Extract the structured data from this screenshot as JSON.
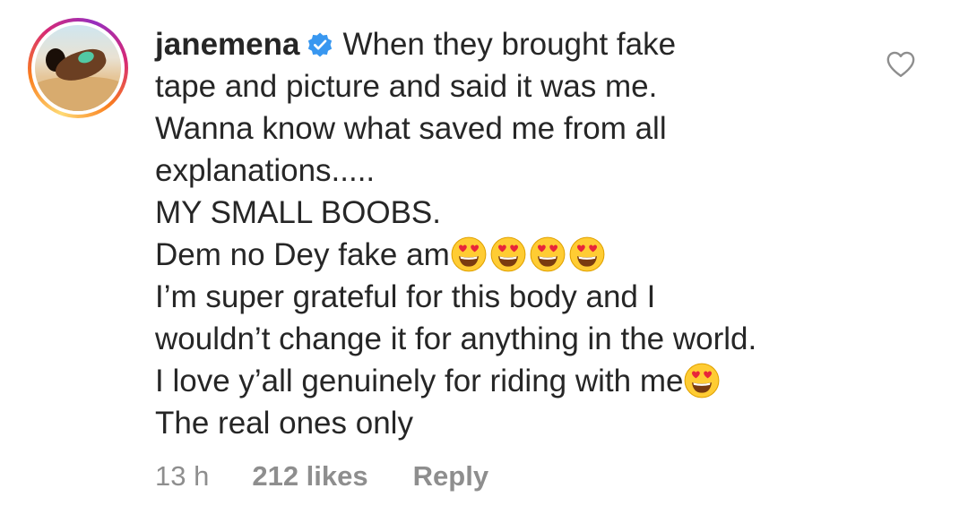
{
  "comment": {
    "username": "janemena",
    "verified_icon": "verified-badge-icon",
    "first_line_text": "When they brought fake",
    "lines": [
      "tape and picture and said it was me.",
      "Wanna know what saved me from all",
      "explanations.....",
      "MY SMALL BOOBS."
    ],
    "emoji_line_1": {
      "text": "Dem no Dey fake am",
      "emoji_icon": "heart-eyes-emoji",
      "emoji_count": 4
    },
    "lines_after": [
      "I’m super grateful for this body and I",
      "wouldn’t change it for anything in the world."
    ],
    "emoji_line_2": {
      "text": "I love y’all genuinely for riding with me",
      "emoji_icon": "heart-eyes-emoji",
      "emoji_count": 1
    },
    "last_line": "The real ones only"
  },
  "meta": {
    "time": "13 h",
    "likes": "212 likes",
    "reply_label": "Reply"
  },
  "like_icon": "heart-outline-icon",
  "colors": {
    "text": "#262626",
    "muted": "#8e8e8e",
    "verified_blue": "#3897f0"
  }
}
